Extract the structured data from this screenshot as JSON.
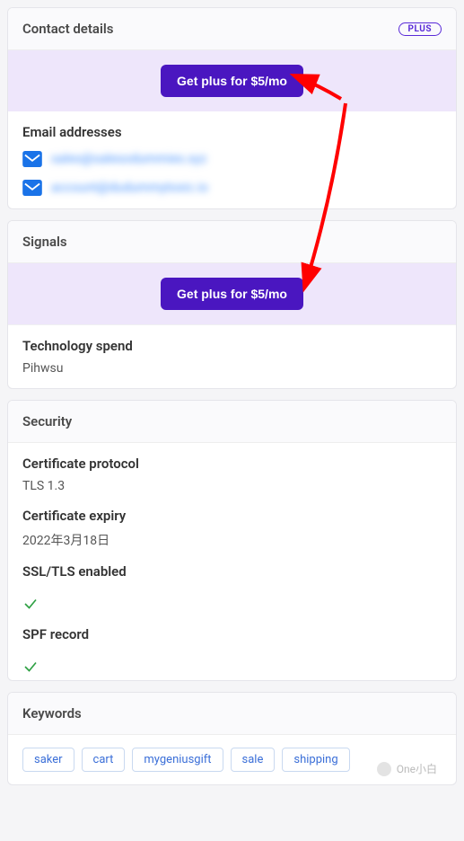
{
  "contact": {
    "header": "Contact details",
    "plus_badge": "PLUS",
    "cta_label": "Get plus for $5/mo",
    "emails_title": "Email addresses",
    "emails": [
      {
        "display": "sales@salesodummies.xyz"
      },
      {
        "display": "account@dudummytoxic.io"
      }
    ]
  },
  "signals": {
    "header": "Signals",
    "cta_label": "Get plus for $5/mo",
    "tech_spend_label": "Technology spend",
    "tech_spend_value": "Pihwsu"
  },
  "security": {
    "header": "Security",
    "cert_protocol_label": "Certificate protocol",
    "cert_protocol_value": "TLS 1.3",
    "cert_expiry_label": "Certificate expiry",
    "cert_expiry_value": "2022年3月18日",
    "ssl_label": "SSL/TLS enabled",
    "ssl_value": true,
    "spf_label": "SPF record",
    "spf_value": true
  },
  "keywords": {
    "header": "Keywords",
    "items": [
      "saker",
      "cart",
      "mygeniusgift",
      "sale",
      "shipping"
    ]
  },
  "watermark": "One小白"
}
